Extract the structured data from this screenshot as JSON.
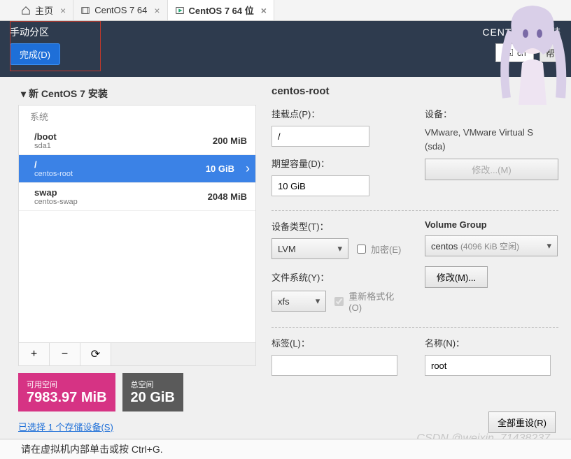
{
  "tabs": [
    {
      "label": "主页",
      "icon": "home"
    },
    {
      "label": "CentOS 7 64",
      "icon": "vm"
    },
    {
      "label": "CentOS 7 64 位",
      "icon": "vm-active"
    }
  ],
  "header": {
    "title": "手动分区",
    "done": "完成(D)",
    "install_title": "CENTOS 7 安装",
    "lang_code": "cn",
    "help": "帮"
  },
  "partition_tree": {
    "heading": "新 CentOS 7 安装",
    "category": "系统",
    "items": [
      {
        "name": "/boot",
        "sub": "sda1",
        "size": "200 MiB",
        "selected": false
      },
      {
        "name": "/",
        "sub": "centos-root",
        "size": "10 GiB",
        "selected": true
      },
      {
        "name": "swap",
        "sub": "centos-swap",
        "size": "2048 MiB",
        "selected": false
      }
    ]
  },
  "toolbar": {
    "add": "+",
    "remove": "−",
    "reload": "⟳"
  },
  "space": {
    "free_label": "可用空间",
    "free_value": "7983.97 MiB",
    "total_label": "总空间",
    "total_value": "20 GiB"
  },
  "storage_link": "已选择 1 个存储设备(S)",
  "detail": {
    "title": "centos-root",
    "mount_label": "挂载点(P)：",
    "mount_value": "/",
    "capacity_label": "期望容量(D)：",
    "capacity_value": "10 GiB",
    "device_label": "设备：",
    "device_text_1": "VMware, VMware Virtual S",
    "device_text_2": "(sda)",
    "modify_disabled": "修改...(M)",
    "devtype_label": "设备类型(T)：",
    "devtype_value": "LVM",
    "encrypt_label": "加密(E)",
    "fs_label": "文件系统(Y)：",
    "fs_value": "xfs",
    "reformat_label": "重新格式化(O)",
    "vg_label": "Volume Group",
    "vg_value": "centos",
    "vg_hint": "(4096 KiB 空闲)",
    "vg_modify": "修改(M)...",
    "tag_label": "标签(L)：",
    "tag_value": "",
    "name_label": "名称(N)：",
    "name_value": "root",
    "reset_all": "全部重设(R)"
  },
  "footer": "请在虚拟机内部单击或按 Ctrl+G.",
  "watermark": "CSDN @weixin_71438237"
}
